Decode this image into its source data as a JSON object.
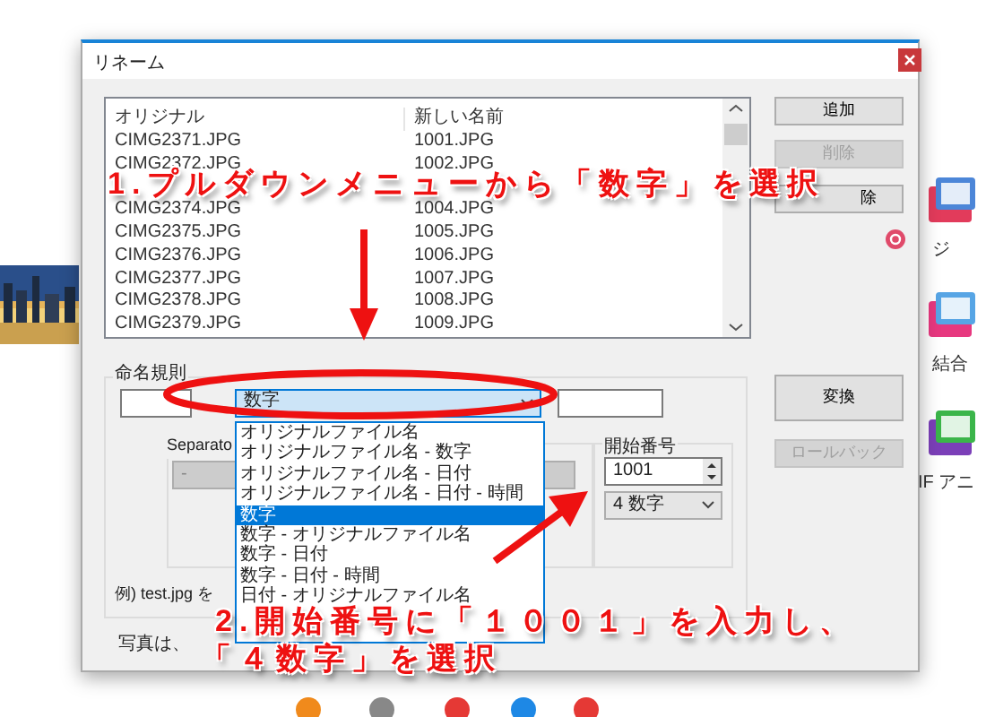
{
  "window": {
    "title": "リネーム"
  },
  "file_list": {
    "columns": [
      "オリジナル",
      "新しい名前"
    ],
    "rows": [
      {
        "original": "CIMG2371.JPG",
        "new_name": "1001.JPG"
      },
      {
        "original": "CIMG2372.JPG",
        "new_name": "1002.JPG"
      },
      {
        "original": "CIMG2374.JPG",
        "new_name": "1004.JPG"
      },
      {
        "original": "CIMG2375.JPG",
        "new_name": "1005.JPG"
      },
      {
        "original": "CIMG2376.JPG",
        "new_name": "1006.JPG"
      },
      {
        "original": "CIMG2377.JPG",
        "new_name": "1007.JPG"
      },
      {
        "original": "CIMG2378.JPG",
        "new_name": "1008.JPG"
      },
      {
        "original": "CIMG2379.JPG",
        "new_name": "1009.JPG"
      }
    ]
  },
  "side_buttons": [
    {
      "label": "追加",
      "disabled": false
    },
    {
      "label": "削除",
      "disabled": true
    },
    {
      "label": "除",
      "disabled": false
    }
  ],
  "naming_rule": {
    "label": "命名規則",
    "pattern": {
      "value": "数字",
      "options": [
        {
          "label": "オリジナルファイル名",
          "selected": false
        },
        {
          "label": "オリジナルファイル名 - 数字",
          "selected": false
        },
        {
          "label": "オリジナルファイル名 - 日付",
          "selected": false
        },
        {
          "label": "オリジナルファイル名 - 日付 - 時間",
          "selected": false
        },
        {
          "label": "数字",
          "selected": true
        },
        {
          "label": "数字 - オリジナルファイル名",
          "selected": false
        },
        {
          "label": "数字 - 日付",
          "selected": false
        },
        {
          "label": "数字 - 日付 - 時間",
          "selected": false
        },
        {
          "label": "日付 - オリジナルファイル名",
          "selected": false
        }
      ]
    },
    "separator": {
      "label": "Separato",
      "value": "-",
      "disabled": true
    },
    "start_number": {
      "label": "開始番号",
      "value": "1001",
      "digits": "4 数字"
    },
    "example": "例) test.jpg を",
    "note": "写真は、"
  },
  "action_buttons": [
    {
      "label": "変換",
      "disabled": false
    },
    {
      "label": "ロールバック",
      "disabled": true
    }
  ],
  "desktop_icons": [
    {
      "label": "ジ"
    },
    {
      "label": "結合"
    },
    {
      "label": "IF アニ"
    }
  ],
  "annotations": [
    {
      "text": "1.プルダウンメニューから「数字」を選択"
    },
    {
      "text": "2.開始番号に「１００１」を入力し、"
    },
    {
      "text": "「４数字」を選択"
    }
  ]
}
